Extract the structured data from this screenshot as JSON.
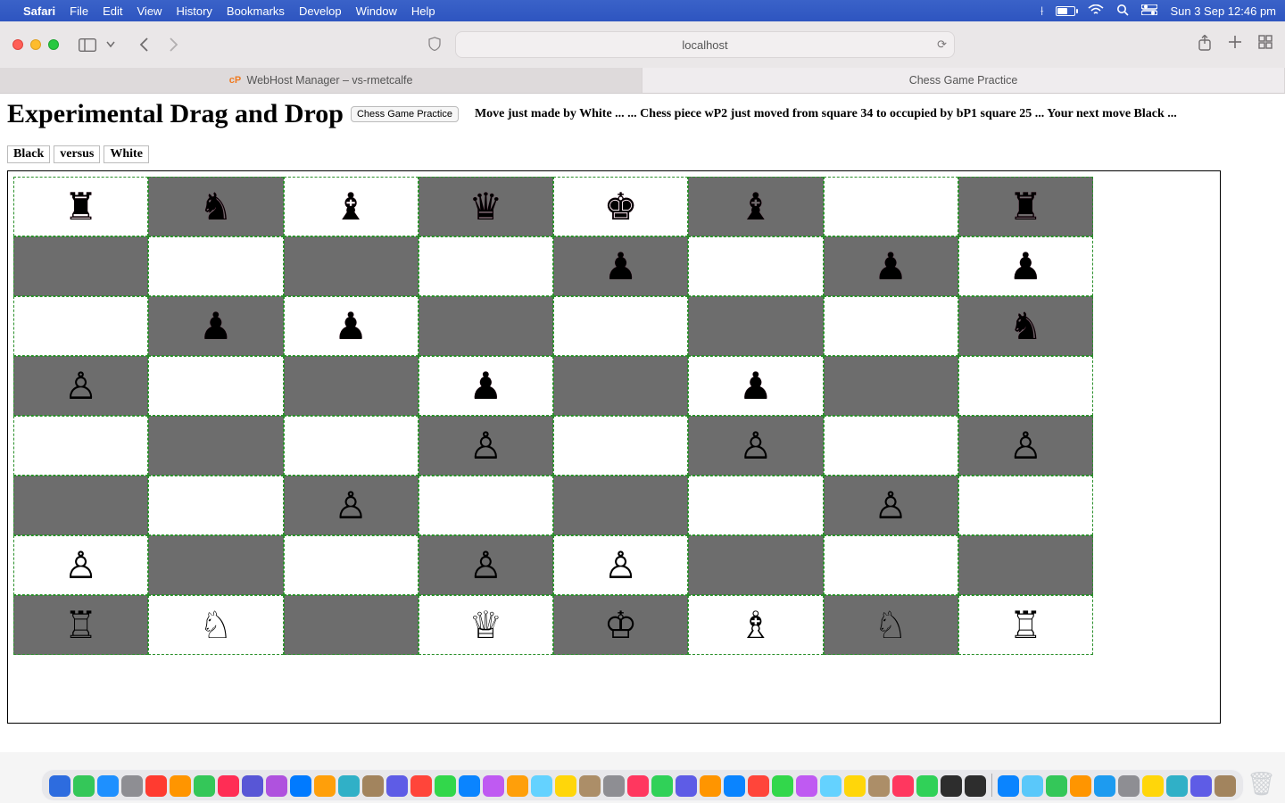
{
  "menubar": {
    "appname": "Safari",
    "items": [
      "File",
      "Edit",
      "View",
      "History",
      "Bookmarks",
      "Develop",
      "Window",
      "Help"
    ],
    "clock": "Sun 3 Sep  12:46 pm"
  },
  "browser": {
    "address": "localhost",
    "tabs": [
      {
        "label": "WebHost Manager – vs-rmetcalfe",
        "favicon": "cP",
        "active": false
      },
      {
        "label": "Chess Game Practice",
        "favicon": "",
        "active": true
      }
    ]
  },
  "page": {
    "heading": "Experimental Drag and Drop",
    "button_label": "Chess Game Practice",
    "status": "Move just made by White ... ... Chess piece wP2 just moved from square 34 to occupied by bP1 square 25 ... Your next move Black ...",
    "vs": {
      "left": "Black",
      "mid": "versus",
      "right": "White"
    }
  },
  "board": {
    "rows": [
      [
        "bR",
        "bN",
        "bB",
        "bQ",
        "bK",
        "bB",
        "",
        "bR"
      ],
      [
        "",
        "",
        "",
        "",
        "bP",
        "",
        "bP",
        "bP"
      ],
      [
        "",
        "bP",
        "bP",
        "",
        "",
        "",
        "",
        "bN"
      ],
      [
        "wP",
        "",
        "",
        "bP",
        "",
        "bP",
        "",
        ""
      ],
      [
        "",
        "",
        "",
        "wP",
        "",
        "wP",
        "",
        "wP"
      ],
      [
        "",
        "",
        "wP",
        "",
        "",
        "",
        "wP",
        ""
      ],
      [
        "wP",
        "",
        "",
        "wP",
        "wP",
        "",
        "",
        ""
      ],
      [
        "wR",
        "wN",
        "",
        "wQ",
        "wK",
        "wB",
        "wN",
        "wR"
      ]
    ]
  },
  "piece_glyphs": {
    "bK": "♚",
    "bQ": "♛",
    "bR": "♜",
    "bB": "♝",
    "bN": "♞",
    "bP": "♟",
    "wK": "♔",
    "wQ": "♕",
    "wR": "♖",
    "wB": "♗",
    "wN": "♘",
    "wP": "♙"
  },
  "dock": {
    "count_left": 39,
    "count_right": 10
  }
}
